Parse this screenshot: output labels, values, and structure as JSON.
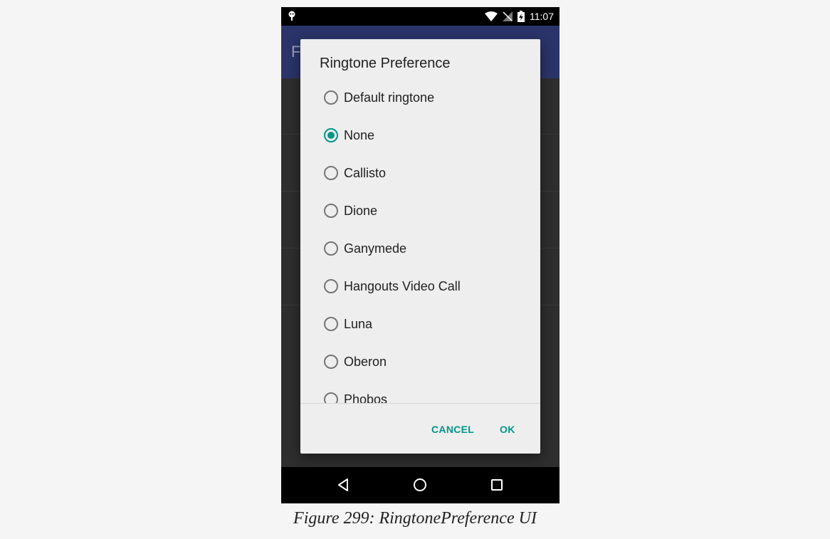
{
  "status_bar": {
    "time": "11:07",
    "left_icon": "android-debug-icon",
    "right_icons": [
      "wifi-icon",
      "no-signal-icon",
      "battery-charging-icon"
    ]
  },
  "app_bar": {
    "initial": "F"
  },
  "dialog": {
    "title": "Ringtone Preference",
    "options": [
      {
        "label": "Default ringtone",
        "checked": false
      },
      {
        "label": "None",
        "checked": true
      },
      {
        "label": "Callisto",
        "checked": false
      },
      {
        "label": "Dione",
        "checked": false
      },
      {
        "label": "Ganymede",
        "checked": false
      },
      {
        "label": "Hangouts Video Call",
        "checked": false
      },
      {
        "label": "Luna",
        "checked": false
      },
      {
        "label": "Oberon",
        "checked": false
      },
      {
        "label": "Phobos",
        "checked": false
      }
    ],
    "cancel_label": "CANCEL",
    "ok_label": "OK",
    "accent_color": "#009688"
  },
  "nav_bar": {
    "icons": [
      "back-icon",
      "home-icon",
      "recents-icon"
    ]
  },
  "caption": "Figure 299: RingtonePreference UI"
}
